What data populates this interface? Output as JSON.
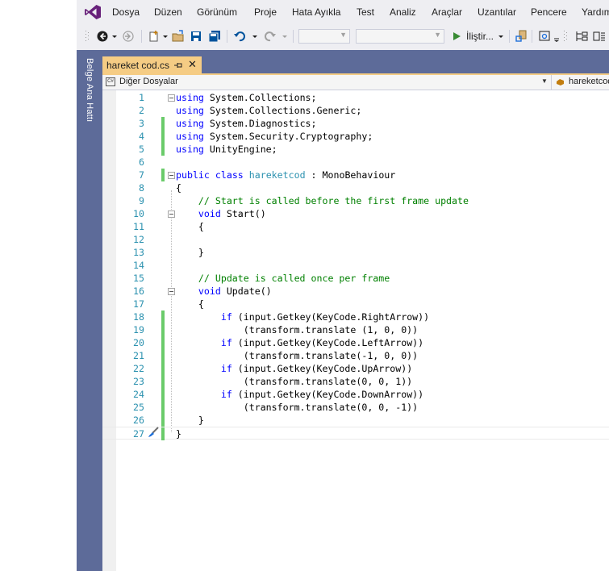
{
  "menu": [
    "Dosya",
    "Düzen",
    "Görünüm",
    "Proje",
    "Hata Ayıkla",
    "Test",
    "Analiz",
    "Araçlar",
    "Uzantılar",
    "Pencere",
    "Yardım"
  ],
  "toolbar": {
    "run_label": "İliştir..."
  },
  "sidebar": {
    "label": "Belge Ana Hattı"
  },
  "tab": {
    "title": "hareket cod.cs"
  },
  "navbar": {
    "scope": "Diğer Dosyalar",
    "class_scope": "hareketcod"
  },
  "colors": {
    "keyword": "#0000FF",
    "type": "#2B91AF",
    "comment": "#008000",
    "line_number": "#2B91AF",
    "change_marker": "#6ACB6A",
    "tab_active": "#F5CC84",
    "frame": "#5D6B99"
  },
  "code": [
    {
      "n": "1",
      "fold": true,
      "changed": false,
      "tokens": [
        [
          "kw",
          "using"
        ],
        [
          "tx",
          " System.Collections;"
        ]
      ]
    },
    {
      "n": "2",
      "fold": false,
      "changed": false,
      "tokens": [
        [
          "kw",
          "using"
        ],
        [
          "tx",
          " System.Collections.Generic;"
        ]
      ]
    },
    {
      "n": "3",
      "fold": false,
      "changed": true,
      "tokens": [
        [
          "kw",
          "using"
        ],
        [
          "tx",
          " System.Diagnostics;"
        ]
      ]
    },
    {
      "n": "4",
      "fold": false,
      "changed": true,
      "tokens": [
        [
          "kw",
          "using"
        ],
        [
          "tx",
          " System.Security.Cryptography;"
        ]
      ]
    },
    {
      "n": "5",
      "fold": false,
      "changed": true,
      "tokens": [
        [
          "kw",
          "using"
        ],
        [
          "tx",
          " UnityEngine;"
        ]
      ]
    },
    {
      "n": "6",
      "fold": false,
      "changed": false,
      "tokens": []
    },
    {
      "n": "7",
      "fold": true,
      "changed": true,
      "tokens": [
        [
          "kw",
          "public"
        ],
        [
          "tx",
          " "
        ],
        [
          "kw",
          "class"
        ],
        [
          "tx",
          " "
        ],
        [
          "ty",
          "hareketcod"
        ],
        [
          "tx",
          " : MonoBehaviour"
        ]
      ]
    },
    {
      "n": "8",
      "fold": false,
      "changed": false,
      "tokens": [
        [
          "tx",
          "{"
        ]
      ]
    },
    {
      "n": "9",
      "fold": false,
      "changed": false,
      "tokens": [
        [
          "tx",
          "    "
        ],
        [
          "cm",
          "// Start is called before the first frame update"
        ]
      ]
    },
    {
      "n": "10",
      "fold": true,
      "changed": false,
      "tokens": [
        [
          "tx",
          "    "
        ],
        [
          "kw",
          "void"
        ],
        [
          "tx",
          " Start()"
        ]
      ]
    },
    {
      "n": "11",
      "fold": false,
      "changed": false,
      "tokens": [
        [
          "tx",
          "    {"
        ]
      ]
    },
    {
      "n": "12",
      "fold": false,
      "changed": false,
      "tokens": []
    },
    {
      "n": "13",
      "fold": false,
      "changed": false,
      "tokens": [
        [
          "tx",
          "    }"
        ]
      ]
    },
    {
      "n": "14",
      "fold": false,
      "changed": false,
      "tokens": []
    },
    {
      "n": "15",
      "fold": false,
      "changed": false,
      "tokens": [
        [
          "tx",
          "    "
        ],
        [
          "cm",
          "// Update is called once per frame"
        ]
      ]
    },
    {
      "n": "16",
      "fold": true,
      "changed": false,
      "tokens": [
        [
          "tx",
          "    "
        ],
        [
          "kw",
          "void"
        ],
        [
          "tx",
          " Update()"
        ]
      ]
    },
    {
      "n": "17",
      "fold": false,
      "changed": false,
      "tokens": [
        [
          "tx",
          "    {"
        ]
      ]
    },
    {
      "n": "18",
      "fold": false,
      "changed": true,
      "tokens": [
        [
          "tx",
          "        "
        ],
        [
          "kw",
          "if"
        ],
        [
          "tx",
          " (input.Getkey(KeyCode.RightArrow))"
        ]
      ]
    },
    {
      "n": "19",
      "fold": false,
      "changed": true,
      "tokens": [
        [
          "tx",
          "            (transform.translate (1, 0, 0))"
        ]
      ]
    },
    {
      "n": "20",
      "fold": false,
      "changed": true,
      "tokens": [
        [
          "tx",
          "        "
        ],
        [
          "kw",
          "if"
        ],
        [
          "tx",
          " (input.Getkey(KeyCode.LeftArrow))"
        ]
      ]
    },
    {
      "n": "21",
      "fold": false,
      "changed": true,
      "tokens": [
        [
          "tx",
          "            (transform.translate(-1, 0, 0))"
        ]
      ]
    },
    {
      "n": "22",
      "fold": false,
      "changed": true,
      "tokens": [
        [
          "tx",
          "        "
        ],
        [
          "kw",
          "if"
        ],
        [
          "tx",
          " (input.Getkey(KeyCode.UpArrow))"
        ]
      ]
    },
    {
      "n": "23",
      "fold": false,
      "changed": true,
      "tokens": [
        [
          "tx",
          "            (transform.translate(0, 0, 1))"
        ]
      ]
    },
    {
      "n": "24",
      "fold": false,
      "changed": true,
      "tokens": [
        [
          "tx",
          "        "
        ],
        [
          "kw",
          "if"
        ],
        [
          "tx",
          " (input.Getkey(KeyCode.DownArrow))"
        ]
      ]
    },
    {
      "n": "25",
      "fold": false,
      "changed": true,
      "tokens": [
        [
          "tx",
          "            (transform.translate(0, 0, -1))"
        ]
      ]
    },
    {
      "n": "26",
      "fold": false,
      "changed": true,
      "tokens": [
        [
          "tx",
          "    }"
        ]
      ]
    },
    {
      "n": "27",
      "fold": false,
      "changed": true,
      "current": true,
      "tokens": [
        [
          "tx",
          "}"
        ]
      ]
    }
  ]
}
